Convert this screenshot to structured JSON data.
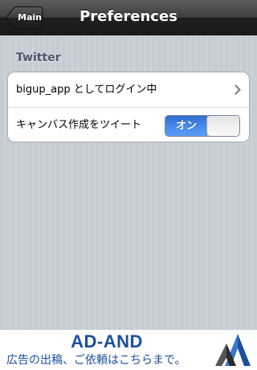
{
  "navbar": {
    "back_label": "Main",
    "title": "Preferences"
  },
  "section": {
    "header": "Twitter"
  },
  "rows": {
    "login_label": "bigup_app としてログイン中",
    "tweet_label": "キャンバス作成をツイート",
    "tweet_switch_label": "オン",
    "tweet_switch_on": true
  },
  "ad": {
    "title": "AD-AND",
    "subtitle": "広告の出稿、ご依頼はこちらまで。"
  },
  "icons": {
    "back": "back-arrow-icon",
    "disclosure": "chevron-right-icon",
    "ad_logo": "ad-and-logo-icon"
  },
  "colors": {
    "navbar": "#2b2b2b",
    "background": "#c5ccd4",
    "section_header": "#4c566c",
    "switch_on": "#3d7fe6",
    "ad_text": "#1b4fa0"
  }
}
